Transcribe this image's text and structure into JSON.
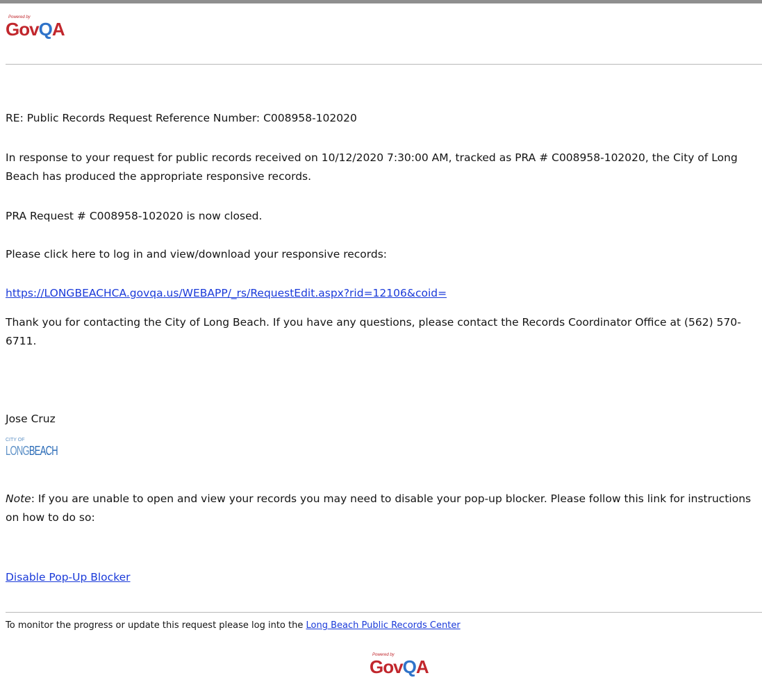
{
  "header_logo": {
    "powered_by": "Powered by",
    "brand_part1": "Gov",
    "brand_part2": "Q",
    "brand_part3": "A"
  },
  "email": {
    "subject_line": "RE: Public Records Request Reference Number: C008958-102020",
    "paragraph1": "In response to your request for public records received on 10/12/2020 7:30:00 AM, tracked as PRA # C008958-102020, the City of Long Beach has produced the appropriate responsive records.",
    "status_line": "PRA Request # C008958-102020 is now closed.",
    "click_instruction": "Please click here to log in and view/download your responsive records:",
    "records_link": "https://LONGBEACHCA.govqa.us/WEBAPP/_rs/RequestEdit.aspx?rid=12106&coid=",
    "thanks_paragraph": "Thank you for contacting the City of Long Beach.  If you have any questions, please contact the Records Coordinator Office at (562) 570-6711.",
    "signature_name": "Jose Cruz",
    "city_logo": {
      "city_of": "CITY OF",
      "long": "LONG",
      "beach": "BEACH"
    },
    "note_label": "Note",
    "note_text": ":  If you are unable to open and view your records you may need to disable your pop-up blocker.  Please follow this link for instructions on how to do so:",
    "popup_link": "Disable Pop-Up Blocker"
  },
  "footer": {
    "monitor_text": "To monitor the progress or update this request please log into the ",
    "center_link": "Long Beach Public Records Center"
  },
  "colors": {
    "link": "#1a3ad9",
    "brand_red": "#c1272d",
    "brand_blue": "#2f73c9",
    "divider": "#b8b8b8"
  }
}
